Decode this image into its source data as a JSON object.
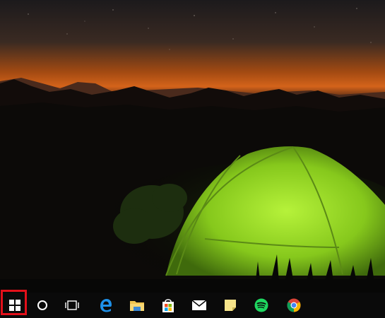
{
  "desktop": {
    "wallpaper": "tent-at-night-icon"
  },
  "taskbar": {
    "background_color": "#0a0a0a",
    "items": [
      {
        "name": "start-button",
        "icon": "windows-logo-icon"
      },
      {
        "name": "cortana-button",
        "icon": "cortana-circle-icon"
      },
      {
        "name": "task-view-button",
        "icon": "task-view-icon"
      },
      {
        "name": "edge-button",
        "icon": "edge-icon"
      },
      {
        "name": "file-explorer-button",
        "icon": "folder-icon"
      },
      {
        "name": "store-button",
        "icon": "store-icon"
      },
      {
        "name": "mail-button",
        "icon": "mail-icon"
      },
      {
        "name": "sticky-notes-button",
        "icon": "sticky-notes-icon"
      },
      {
        "name": "spotify-button",
        "icon": "spotify-icon"
      },
      {
        "name": "chrome-button",
        "icon": "chrome-icon"
      }
    ]
  },
  "highlight": {
    "target": "start-button",
    "color": "#e3101a"
  }
}
